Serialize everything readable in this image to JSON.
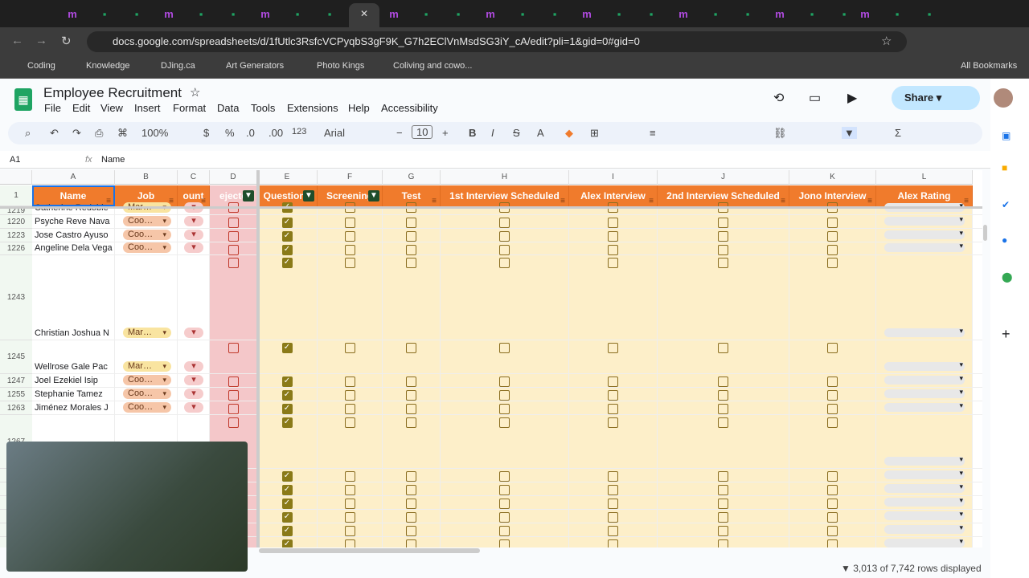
{
  "browser": {
    "url": "docs.google.com/spreadsheets/d/1fUtlc3RsfcVCPyqbS3gF9K_G7h2EClVnMsdSG3iY_cA/edit?pli=1&gid=0#gid=0",
    "bookmarks": [
      "Coding",
      "Knowledge",
      "DJing.ca",
      "Art Generators",
      "Photo Kings",
      "Coliving and cowo..."
    ],
    "all_bookmarks": "All Bookmarks"
  },
  "doc": {
    "title": "Employee Recruitment",
    "menus": [
      "File",
      "Edit",
      "View",
      "Insert",
      "Format",
      "Data",
      "Tools",
      "Extensions",
      "Help",
      "Accessibility"
    ],
    "share": "Share"
  },
  "toolbar": {
    "zoom": "100%",
    "currency": "$",
    "percent": "%",
    "dec_less": ".0",
    "dec_more": ".00",
    "format": "123",
    "font": "Arial",
    "font_size": "10"
  },
  "formula": {
    "cell_ref": "A1",
    "fx": "fx",
    "value": "Name"
  },
  "columns": [
    "A",
    "B",
    "C",
    "D",
    "E",
    "F",
    "G",
    "H",
    "I",
    "J",
    "K",
    "L"
  ],
  "headers": [
    "Name",
    "Job",
    "ount",
    "ejecte",
    "Questions",
    "Screening",
    "Test",
    "1st Interview Scheduled",
    "Alex Interview",
    "2nd Interview Scheduled",
    "Jono Interview",
    "Alex Rating"
  ],
  "header_row_num": "1",
  "rows": [
    {
      "num": "1219",
      "name": "Catherine Redoble",
      "job": "Mar…",
      "e": true
    },
    {
      "num": "1220",
      "name": "Psyche Reve Nava",
      "job": "Coo…",
      "e": true
    },
    {
      "num": "1223",
      "name": "Jose Castro Ayuso",
      "job": "Coo…",
      "e": true
    },
    {
      "num": "1226",
      "name": "Angeline Dela Vega",
      "job": "Coo…",
      "e": true
    },
    {
      "num": "1243",
      "name": "Christian Joshua N",
      "job": "Mar…",
      "e": true
    },
    {
      "num": "1245",
      "name": "Wellrose Gale Pac",
      "job": "Mar…",
      "e": true
    },
    {
      "num": "1247",
      "name": "Joel Ezekiel Isip",
      "job": "Coo…",
      "e": true
    },
    {
      "num": "1255",
      "name": "Stephanie Tamez",
      "job": "Coo…",
      "e": true
    },
    {
      "num": "1263",
      "name": "Jiménez Morales J",
      "job": "Coo…",
      "e": true
    },
    {
      "num": "1267",
      "name": "",
      "job": "",
      "e": true
    },
    {
      "num": "",
      "name": "",
      "job": "",
      "e": true
    },
    {
      "num": "",
      "name": "",
      "job": "",
      "e": true
    },
    {
      "num": "",
      "name": "",
      "job": "",
      "e": true
    },
    {
      "num": "",
      "name": "",
      "job": "",
      "e": true
    },
    {
      "num": "",
      "name": "",
      "job": "",
      "e": true
    },
    {
      "num": "",
      "name": "",
      "job": "",
      "e": true
    }
  ],
  "status": "3,013 of 7,742 rows displayed",
  "colors": {
    "header": "#f07b2c",
    "rejected_col": "#f4c7c9",
    "stage_cols": "#fdefc9",
    "name_col": "#f1f8f1",
    "coo_chip": "#f6c6a8",
    "mar_chip": "#f9e4a0"
  }
}
